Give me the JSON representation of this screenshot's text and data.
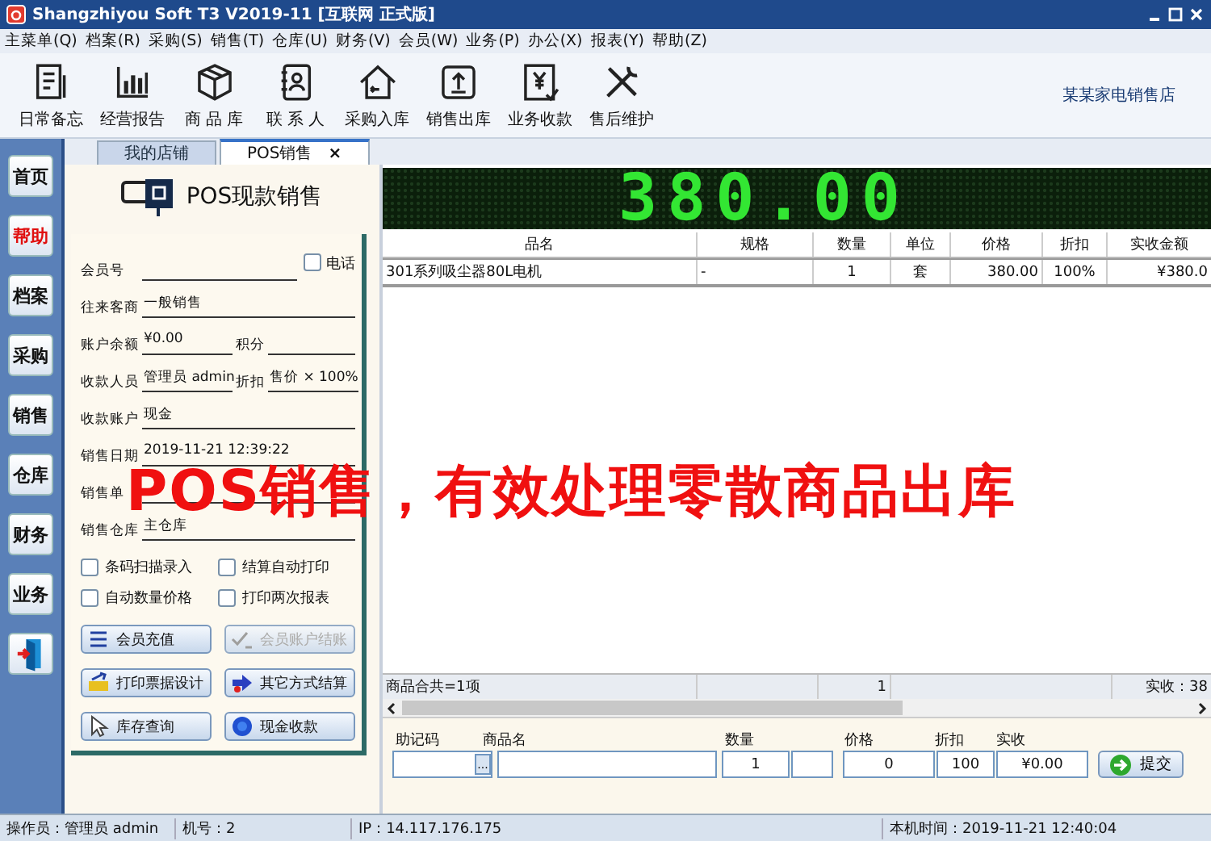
{
  "window": {
    "title": "Shangzhiyou Soft T3 V2019-11 [互联网 正式版]"
  },
  "menu": [
    "主菜单(Q)",
    "档案(R)",
    "采购(S)",
    "销售(T)",
    "仓库(U)",
    "财务(V)",
    "会员(W)",
    "业务(P)",
    "办公(X)",
    "报表(Y)",
    "帮助(Z)"
  ],
  "toolbar": [
    {
      "kind": "memo",
      "label": "日常备忘"
    },
    {
      "kind": "chart",
      "label": "经营报告"
    },
    {
      "kind": "box",
      "label": "商 品 库"
    },
    {
      "kind": "contact",
      "label": "联 系 人"
    },
    {
      "kind": "house",
      "label": "采购入库"
    },
    {
      "kind": "upload",
      "label": "销售出库"
    },
    {
      "kind": "yen",
      "label": "业务收款"
    },
    {
      "kind": "tools",
      "label": "售后维护"
    }
  ],
  "shop_name": "某某家电销售店",
  "tabs": [
    {
      "label": "我的店铺",
      "selected": false
    },
    {
      "label": "POS销售",
      "selected": true,
      "close": "×"
    }
  ],
  "sidebar": [
    {
      "label": "首页",
      "highlighted": false
    },
    {
      "label": "帮助",
      "highlighted": true
    },
    {
      "label": "档案",
      "highlighted": false
    },
    {
      "label": "采购",
      "highlighted": false
    },
    {
      "label": "销售",
      "highlighted": false
    },
    {
      "label": "仓库",
      "highlighted": false
    },
    {
      "label": "财务",
      "highlighted": false
    },
    {
      "label": "业务",
      "highlighted": false
    }
  ],
  "pos_title": "POS现款销售",
  "form": [
    {
      "kind": "check",
      "label": "会员号",
      "check_label": "电话",
      "checked": false
    },
    {
      "kind": "plain",
      "label": "往来客商",
      "value": "一般销售"
    },
    {
      "kind": "pair",
      "label": "账户余额",
      "value": "¥0.00",
      "label2": "积分"
    },
    {
      "kind": "pair",
      "label": "收款人员",
      "value": "管理员 admin",
      "label2": "折扣",
      "value2": "售价 × 100%"
    },
    {
      "kind": "plain",
      "label": "收款账户",
      "value": "现金"
    },
    {
      "kind": "plain",
      "label": "销售日期",
      "value": "2019-11-21 12:39:22"
    },
    {
      "kind": "plain",
      "label": "销售单"
    },
    {
      "kind": "plain",
      "label": "销售仓库",
      "value": "主仓库"
    }
  ],
  "options": [
    {
      "label": "条码扫描录入",
      "checked": false
    },
    {
      "label": "结算自动打印",
      "checked": false
    },
    {
      "label": "自动数量价格",
      "checked": false
    },
    {
      "label": "打印两次报表",
      "checked": false
    }
  ],
  "actions": [
    {
      "kind": "list",
      "label": "会员充值",
      "disabled": false
    },
    {
      "kind": "check",
      "label": "会员账户结账",
      "disabled": true
    },
    {
      "kind": "print",
      "label": "打印票据设计",
      "disabled": false
    },
    {
      "kind": "arrow",
      "label": "其它方式结算",
      "disabled": false
    },
    {
      "kind": "cursor",
      "label": "库存查询",
      "disabled": false
    },
    {
      "kind": "coin",
      "label": "现金收款",
      "disabled": false
    }
  ],
  "display": "380.00",
  "table": {
    "columns": [
      "品名",
      "规格",
      "数量",
      "单位",
      "价格",
      "折扣",
      "实收金额"
    ],
    "rows": [
      [
        "301系列吸尘器80L电机",
        "-",
        "1",
        "套",
        "380.00",
        "100%",
        "¥380.0"
      ]
    ],
    "summary": {
      "count": "商品合共=1项",
      "quantity": "1",
      "total": "实收：38"
    }
  },
  "entry": {
    "labels": [
      "助记码",
      "商品名",
      "数量",
      "价格",
      "折扣",
      "实收"
    ],
    "quantity": "1",
    "price": "0",
    "discount": "100",
    "received": "¥0.00",
    "browse": "...",
    "submit": "提交"
  },
  "status_bar": [
    "操作员：管理员 admin",
    "机号：2",
    "IP：14.117.176.175",
    "本机时间：2019-11-21 12:40:04"
  ],
  "banner": "POS销售，有效处理零散商品出库"
}
